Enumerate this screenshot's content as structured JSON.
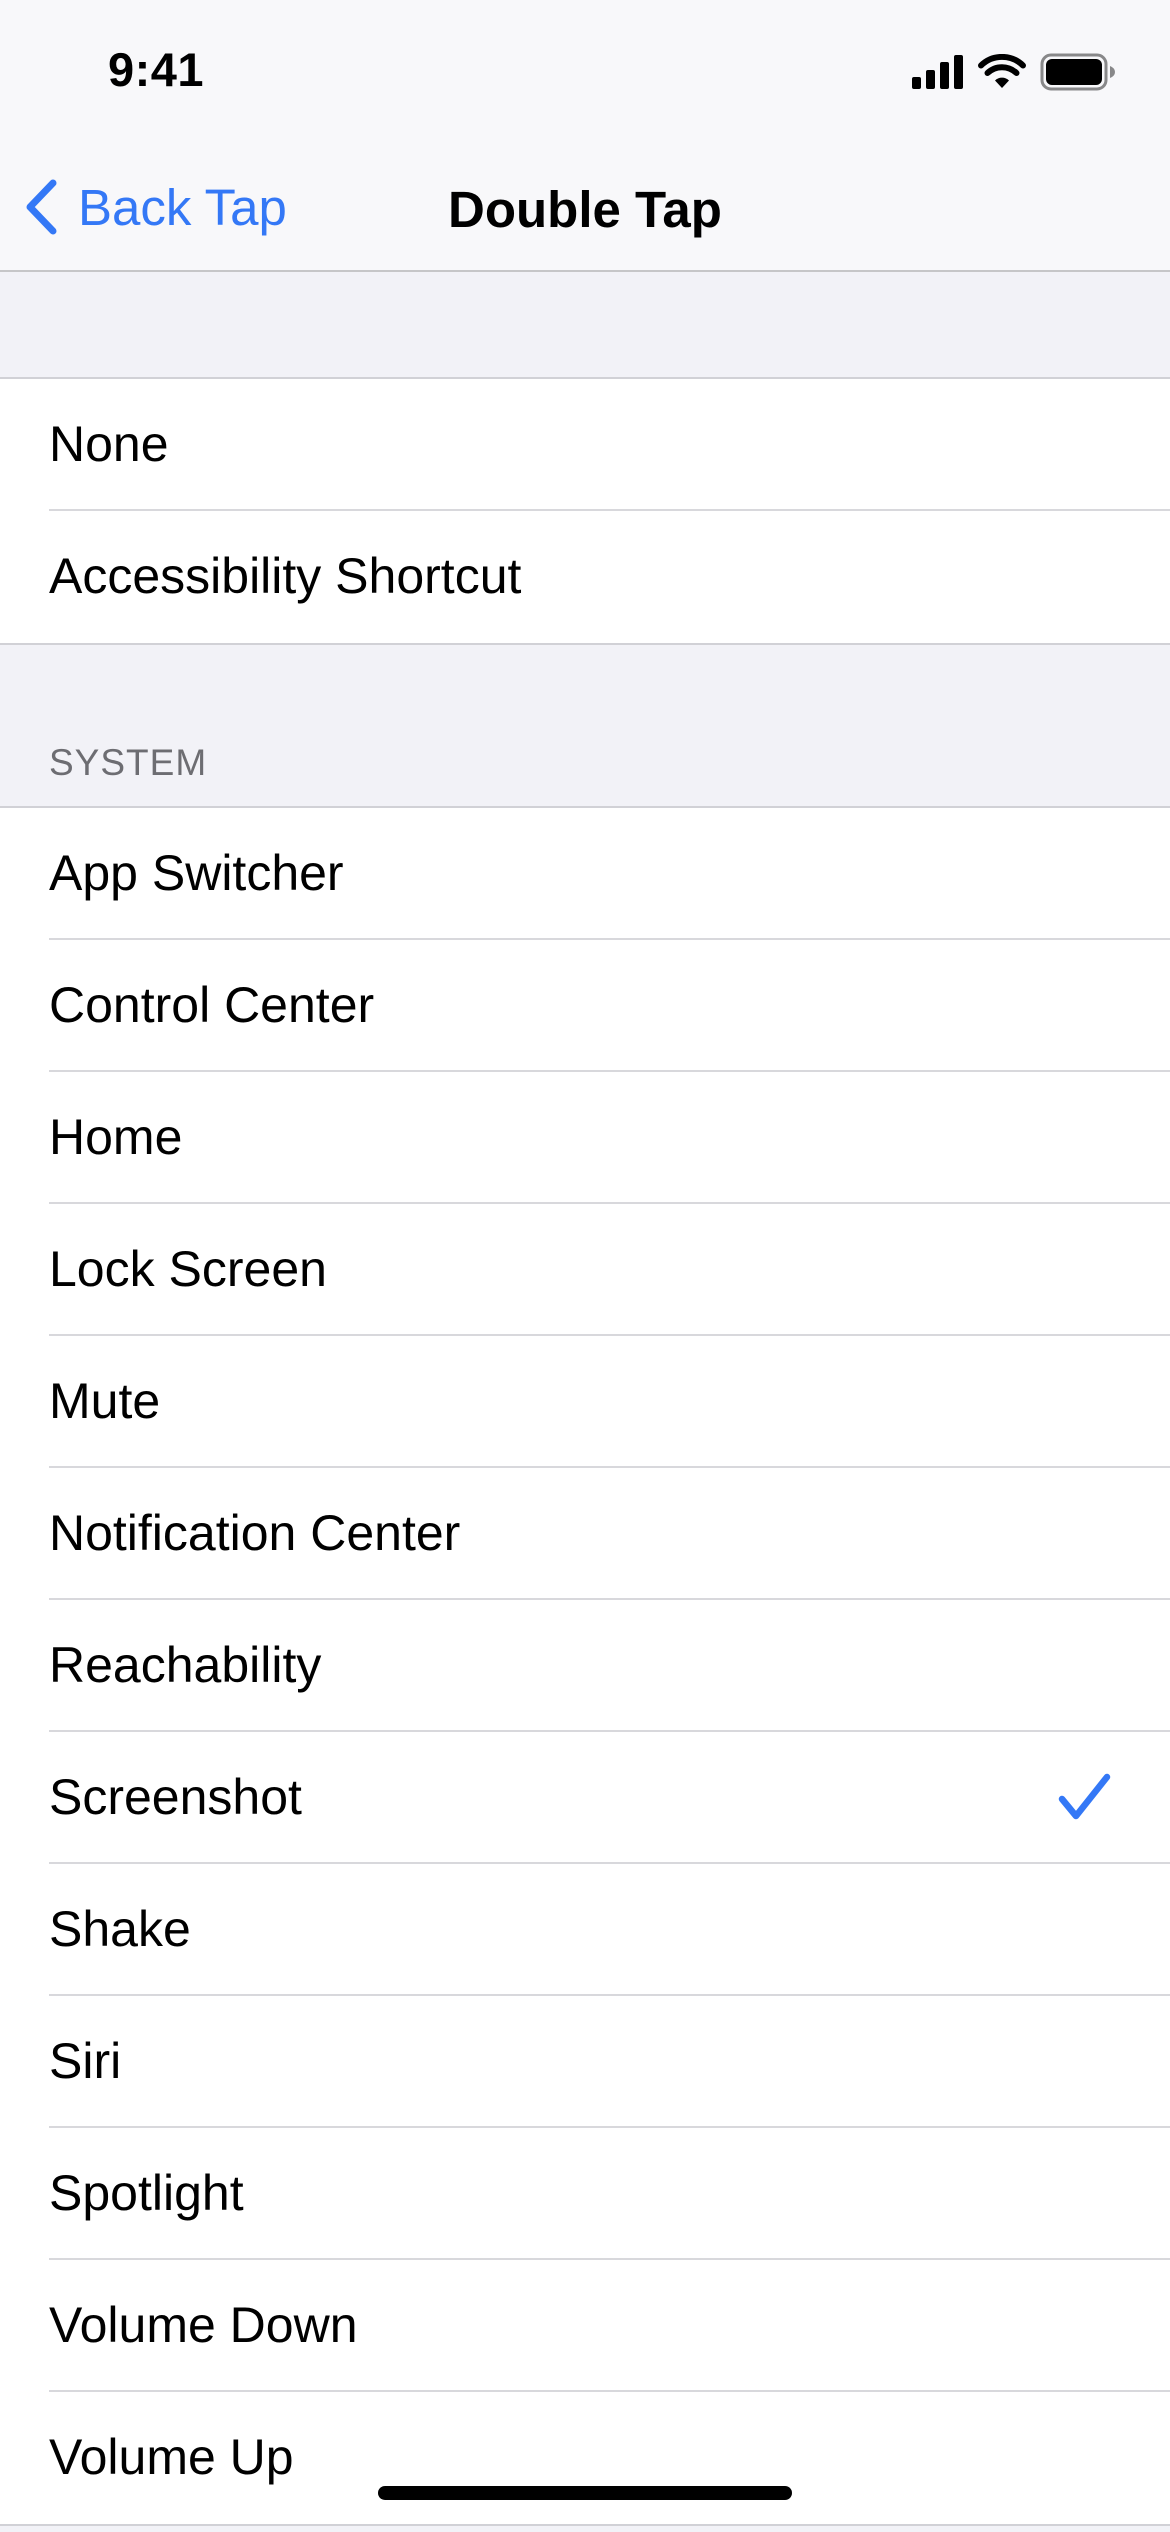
{
  "status_bar": {
    "time": "9:41",
    "icons": [
      "cellular-signal-icon",
      "wifi-icon",
      "battery-icon"
    ]
  },
  "nav": {
    "back_label": "Back Tap",
    "title": "Double Tap",
    "accent_color": "#3478f6"
  },
  "group1": {
    "items": [
      {
        "label": "None"
      },
      {
        "label": "Accessibility Shortcut"
      }
    ]
  },
  "system_section": {
    "header": "SYSTEM",
    "items": [
      {
        "label": "App Switcher"
      },
      {
        "label": "Control Center"
      },
      {
        "label": "Home"
      },
      {
        "label": "Lock Screen"
      },
      {
        "label": "Mute"
      },
      {
        "label": "Notification Center"
      },
      {
        "label": "Reachability"
      },
      {
        "label": "Screenshot",
        "selected": true
      },
      {
        "label": "Shake"
      },
      {
        "label": "Siri"
      },
      {
        "label": "Spotlight"
      },
      {
        "label": "Volume Down"
      },
      {
        "label": "Volume Up"
      }
    ]
  }
}
